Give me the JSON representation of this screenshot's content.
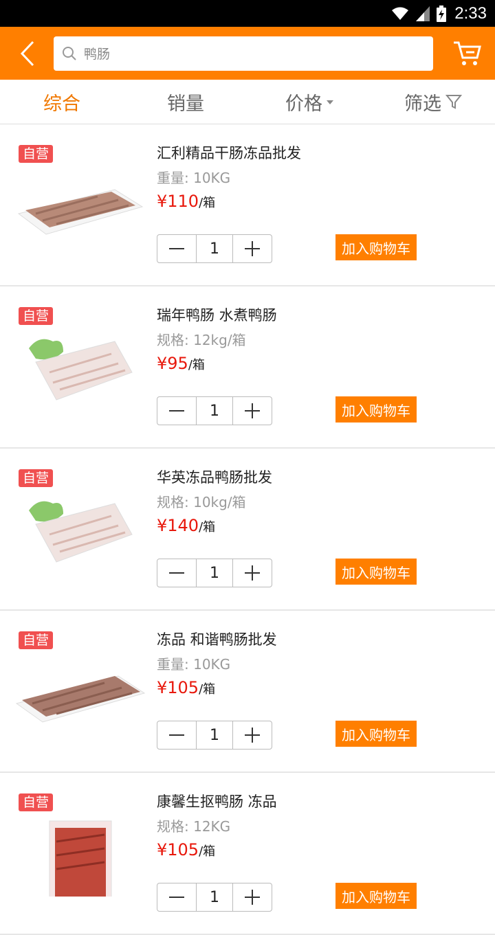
{
  "status": {
    "time": "2:33"
  },
  "search": {
    "query": "鸭肠"
  },
  "tabs": [
    {
      "label": "综合"
    },
    {
      "label": "销量"
    },
    {
      "label": "价格"
    },
    {
      "label": "筛选"
    }
  ],
  "items": [
    {
      "badge": "自营",
      "name": "汇利精品干肠冻品批发",
      "spec": "重量: 10KG",
      "price": "¥110",
      "unit": "/箱",
      "qty": "1",
      "add_label": "加入购物车"
    },
    {
      "badge": "自营",
      "name": "瑞年鸭肠 水煮鸭肠",
      "spec": "规格: 12kg/箱",
      "price": "¥95",
      "unit": "/箱",
      "qty": "1",
      "add_label": "加入购物车"
    },
    {
      "badge": "自营",
      "name": "华英冻品鸭肠批发",
      "spec": "规格: 10kg/箱",
      "price": "¥140",
      "unit": "/箱",
      "qty": "1",
      "add_label": "加入购物车"
    },
    {
      "badge": "自营",
      "name": "冻品 和谐鸭肠批发",
      "spec": "重量: 10KG",
      "price": "¥105",
      "unit": "/箱",
      "qty": "1",
      "add_label": "加入购物车"
    },
    {
      "badge": "自营",
      "name": "康馨生抠鸭肠 冻品",
      "spec": "规格: 12KG",
      "price": "¥105",
      "unit": "/箱",
      "qty": "1",
      "add_label": "加入购物车"
    }
  ],
  "icons": {
    "back": "back-arrow-icon",
    "search": "search-icon",
    "cart": "cart-icon",
    "filter": "filter-icon"
  },
  "colors": {
    "accent": "#ff7f00",
    "price": "#e8180c",
    "badge": "#f05050"
  }
}
